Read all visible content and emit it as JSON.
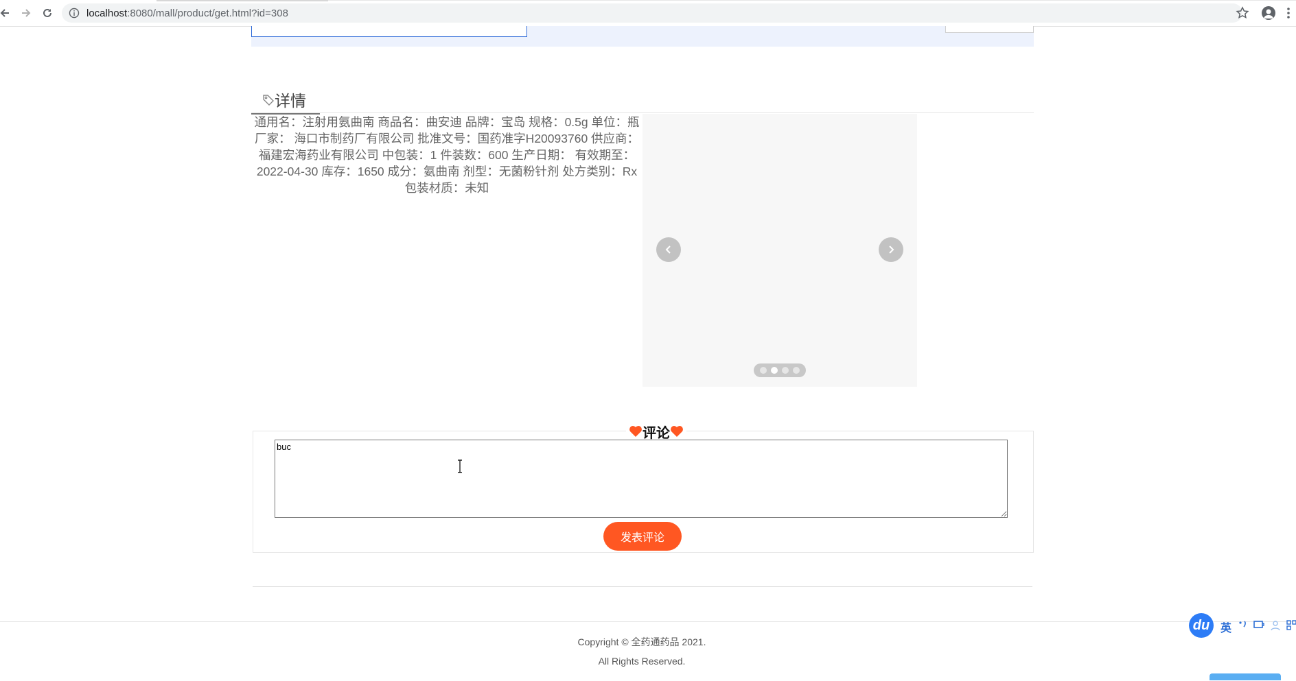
{
  "browser": {
    "url_host": "localhost",
    "url_rest": ":8080/mall/product/get.html?id=308"
  },
  "detail": {
    "tab_label": "详情",
    "description": "通用名：注射用氨曲南 商品名：曲安迪 品牌：宝岛 规格：0.5g 单位：瓶 厂家： 海口市制药厂有限公司 批准文号：国药准字H20093760 供应商：福建宏海药业有限公司 中包装：1 件装数：600 生产日期： 有效期至：2022-04-30 库存：1650 成分：氨曲南 剂型：无菌粉针剂 处方类别：Rx 包装材质：未知"
  },
  "carousel": {
    "dot_count": 4,
    "active_index": 1
  },
  "comments": {
    "title": "评论",
    "input_value": "buc",
    "submit_label": "发表评论",
    "heart_color": "#ff5722"
  },
  "footer": {
    "copyright": "Copyright © 全药通药品 2021.",
    "rights": "All Rights Reserved."
  },
  "ime": {
    "logo": "du",
    "lang": "英"
  }
}
